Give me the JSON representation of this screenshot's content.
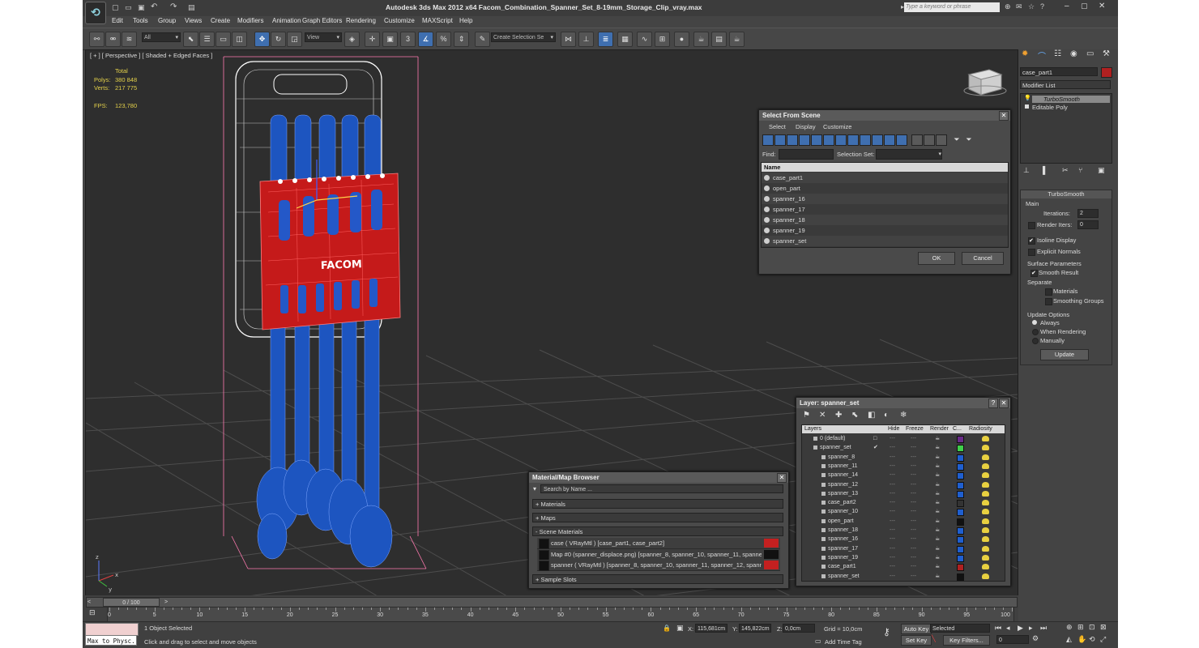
{
  "window": {
    "title": "Autodesk 3ds Max  2012 x64      Facom_Combination_Spanner_Set_8-19mm_Storage_Clip_vray.max",
    "search_placeholder": "Type a keyword or phrase"
  },
  "menu": [
    "Edit",
    "Tools",
    "Group",
    "Views",
    "Create",
    "Modifiers",
    "Animation",
    "Graph Editors",
    "Rendering",
    "Customize",
    "MAXScript",
    "Help"
  ],
  "toolbar": {
    "filter": "All",
    "ref_coord": "View",
    "selection_set_placeholder": "Create Selection Se"
  },
  "viewport": {
    "label": "[ + ] [ Perspective ] [ Shaded + Edged Faces ]",
    "stats": {
      "total_label": "Total",
      "polys_label": "Polys:",
      "polys": "380 848",
      "verts_label": "Verts:",
      "verts": "217 775",
      "fps_label": "FPS:",
      "fps": "123,780"
    },
    "brand": "FACOM",
    "axes": {
      "x": "x",
      "y": "y",
      "z": "z"
    }
  },
  "select_from_scene": {
    "title": "Select From Scene",
    "menu": [
      "Select",
      "Display",
      "Customize"
    ],
    "find_label": "Find:",
    "selection_set_label": "Selection Set:",
    "column": "Name",
    "items": [
      "case_part1",
      "open_part",
      "spanner_16",
      "spanner_17",
      "spanner_18",
      "spanner_19",
      "spanner_set"
    ],
    "ok": "OK",
    "cancel": "Cancel"
  },
  "layer_manager": {
    "title": "Layer: spanner_set",
    "columns": [
      "Layers",
      "Hide",
      "Freeze",
      "Render",
      "C...",
      "Radiosity"
    ],
    "rows": [
      {
        "name": "0 (default)",
        "indent": 1,
        "color": "#6a2a8a",
        "check": "□"
      },
      {
        "name": "spanner_set",
        "indent": 1,
        "color": "#3fd04a",
        "check": "✔"
      },
      {
        "name": "spanner_8",
        "indent": 2,
        "color": "#1f5fd0",
        "check": ""
      },
      {
        "name": "spanner_11",
        "indent": 2,
        "color": "#1f5fd0",
        "check": ""
      },
      {
        "name": "spanner_14",
        "indent": 2,
        "color": "#1f5fd0",
        "check": ""
      },
      {
        "name": "spanner_12",
        "indent": 2,
        "color": "#1f5fd0",
        "check": ""
      },
      {
        "name": "spanner_13",
        "indent": 2,
        "color": "#1f5fd0",
        "check": ""
      },
      {
        "name": "case_part2",
        "indent": 2,
        "color": "#333333",
        "check": ""
      },
      {
        "name": "spanner_10",
        "indent": 2,
        "color": "#1f5fd0",
        "check": ""
      },
      {
        "name": "open_part",
        "indent": 2,
        "color": "#111111",
        "check": ""
      },
      {
        "name": "spanner_18",
        "indent": 2,
        "color": "#1f5fd0",
        "check": ""
      },
      {
        "name": "spanner_16",
        "indent": 2,
        "color": "#1f5fd0",
        "check": ""
      },
      {
        "name": "spanner_17",
        "indent": 2,
        "color": "#1f5fd0",
        "check": ""
      },
      {
        "name": "spanner_19",
        "indent": 2,
        "color": "#1f5fd0",
        "check": ""
      },
      {
        "name": "case_part1",
        "indent": 2,
        "color": "#b02020",
        "check": ""
      },
      {
        "name": "spanner_set",
        "indent": 2,
        "color": "#111111",
        "check": ""
      }
    ]
  },
  "material_browser": {
    "title": "Material/Map Browser",
    "search_placeholder": "Search by Name ...",
    "groups": [
      "+ Materials",
      "+ Maps",
      "- Scene Materials",
      "+ Sample Slots"
    ],
    "materials": [
      {
        "label": "case  ( VRayMtl )  [case_part1, case_part2]",
        "swatch": "#c42020"
      },
      {
        "label": "Map #0 (spanner_displace.png) [spanner_8, spanner_10, spanner_11, spanner_...",
        "swatch": "#111111"
      },
      {
        "label": "spanner  ( VRayMtl )  [spanner_8, spanner_10, spanner_11, spanner_12, spanne...",
        "swatch": "#c42020"
      }
    ]
  },
  "command_panel": {
    "object_name": "case_part1",
    "modifier_list": "Modifier List",
    "stack": [
      "TurboSmooth",
      "Editable Poly"
    ],
    "rollout_title": "TurboSmooth",
    "main_label": "Main",
    "iterations_label": "Iterations:",
    "iterations": "2",
    "render_iters_label": "Render Iters:",
    "render_iters": "0",
    "isoline_label": "Isoline Display",
    "explicit_normals_label": "Explicit Normals",
    "surface_params_label": "Surface Parameters",
    "smooth_result_label": "Smooth Result",
    "separate_label": "Separate",
    "materials_label": "Materials",
    "smoothing_groups_label": "Smoothing Groups",
    "update_options_label": "Update Options",
    "always_label": "Always",
    "when_rendering_label": "When Rendering",
    "manually_label": "Manually",
    "update_button": "Update"
  },
  "timeline": {
    "frame": "0 / 100",
    "ticks": [
      "0",
      "5",
      "10",
      "15",
      "20",
      "25",
      "30",
      "35",
      "40",
      "45",
      "50",
      "55",
      "60",
      "65",
      "70",
      "75",
      "80",
      "85",
      "90",
      "95",
      "100"
    ]
  },
  "status": {
    "script_listener": "Max to Physc.",
    "selected_count": "1 Object Selected",
    "prompt": "Click and drag to select and move objects",
    "x_label": "X:",
    "x": "115,681cm",
    "y_label": "Y:",
    "y": "145,822cm",
    "z_label": "Z:",
    "z": "0,0cm",
    "grid": "Grid = 10,0cm",
    "add_time_tag": "Add Time Tag",
    "auto_key": "Auto Key",
    "set_key": "Set Key",
    "selected_dropdown": "Selected",
    "key_filters": "Key Filters...",
    "current_frame": "0"
  }
}
